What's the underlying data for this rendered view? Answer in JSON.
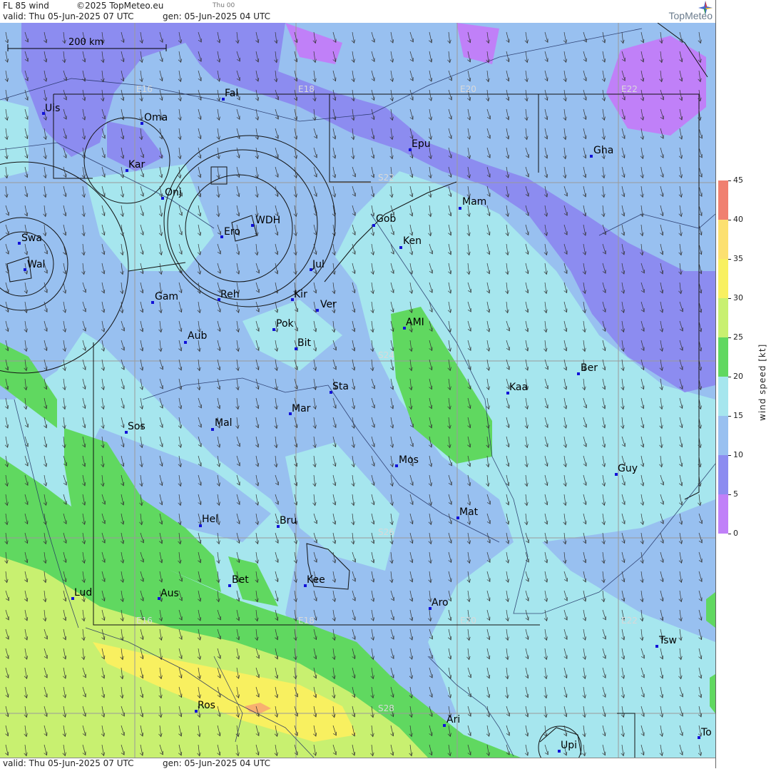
{
  "header": {
    "title": "FL 85 wind",
    "copyright": "©2025 TopMeteo.eu",
    "tab": "Thu 00",
    "valid": "valid:  Thu   05-Jun-2025  07 UTC",
    "generated": "gen:  05-Jun-2025 04 UTC"
  },
  "footer": {
    "valid": "valid:  Thu   05-Jun-2025  07 UTC",
    "generated": "gen:  05-Jun-2025 04 UTC"
  },
  "logo": {
    "text": "TopMeteo",
    "icon": "compass-star-icon"
  },
  "scalebar": {
    "label": "200 km"
  },
  "legend": {
    "title": "wind  speed  [kt]",
    "ticks": [
      "45",
      "40",
      "35",
      "30",
      "25",
      "20",
      "15",
      "10",
      "5",
      "0"
    ],
    "colors": [
      "#f08070",
      "#f8b070",
      "#fce070",
      "#f8f060",
      "#c8f070",
      "#60d860",
      "#a6e6ee",
      "#98c0f0",
      "#8c8cf0",
      "#c080f8"
    ]
  },
  "grid_labels": [
    {
      "text": "E16"
    },
    {
      "text": "E18"
    },
    {
      "text": "E20"
    },
    {
      "text": "E22"
    },
    {
      "text": "S22"
    },
    {
      "text": "S24"
    },
    {
      "text": "S26"
    },
    {
      "text": "S28"
    },
    {
      "text": "E16"
    },
    {
      "text": "E18"
    },
    {
      "text": "E20"
    },
    {
      "text": "E22"
    }
  ],
  "places": [
    {
      "name": "Uis"
    },
    {
      "name": "Oma"
    },
    {
      "name": "Fal"
    },
    {
      "name": "Kar"
    },
    {
      "name": "Epu"
    },
    {
      "name": "Gha"
    },
    {
      "name": "Onj"
    },
    {
      "name": "Mam"
    },
    {
      "name": "Swa"
    },
    {
      "name": "Gob"
    },
    {
      "name": "WDH"
    },
    {
      "name": "Ero"
    },
    {
      "name": "Ken"
    },
    {
      "name": "Wal"
    },
    {
      "name": "Jul"
    },
    {
      "name": "Gam"
    },
    {
      "name": "Reh"
    },
    {
      "name": "Kir"
    },
    {
      "name": "Ver"
    },
    {
      "name": "AMI"
    },
    {
      "name": "Pok"
    },
    {
      "name": "Aub"
    },
    {
      "name": "Bit"
    },
    {
      "name": "Ber"
    },
    {
      "name": "Sta"
    },
    {
      "name": "Kaa"
    },
    {
      "name": "Mar"
    },
    {
      "name": "Sos"
    },
    {
      "name": "Mal"
    },
    {
      "name": "Mos"
    },
    {
      "name": "Guy"
    },
    {
      "name": "Mat"
    },
    {
      "name": "Hel"
    },
    {
      "name": "Bru"
    },
    {
      "name": "Bet"
    },
    {
      "name": "Kee"
    },
    {
      "name": "Lud"
    },
    {
      "name": "Aus"
    },
    {
      "name": "Aro"
    },
    {
      "name": "Tsw"
    },
    {
      "name": "Ros"
    },
    {
      "name": "Ari"
    },
    {
      "name": "Upi"
    },
    {
      "name": "To"
    }
  ]
}
